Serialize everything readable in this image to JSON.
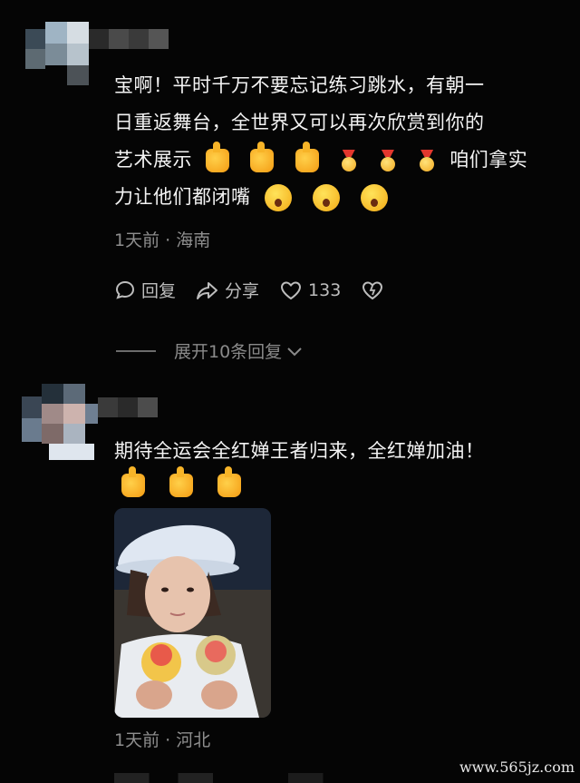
{
  "comments": [
    {
      "text_line1": "宝啊！平时千万不要忘记练习跳水，有朝一",
      "text_line2": "日重返舞台，全世界又可以再次欣赏到你的",
      "text_line3_prefix": "艺术展示",
      "text_line3_suffix": "咱们拿实",
      "text_line4_prefix": "力让他们都闭嘴",
      "meta": "1天前 · 海南",
      "reply_label": "回复",
      "share_label": "分享",
      "like_count": "133",
      "expand_label": "展开10条回复"
    },
    {
      "text": "期待全运会全红婵王者归来，全红婵加油！",
      "meta": "1天前 · 河北"
    }
  ],
  "watermark": "www.565jz.com",
  "icons": [
    "thumbs-up-icon",
    "medal-icon",
    "shocked-face-icon",
    "comment-bubble-icon",
    "share-arrow-icon",
    "heart-icon",
    "dislike-heart-icon",
    "chevron-down-icon"
  ]
}
